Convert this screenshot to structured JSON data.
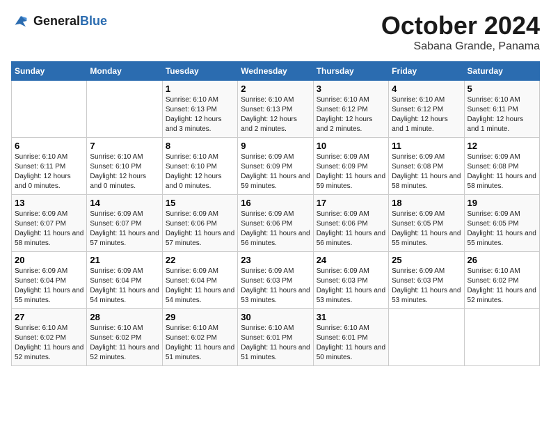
{
  "header": {
    "logo_line1": "General",
    "logo_line2": "Blue",
    "month": "October 2024",
    "location": "Sabana Grande, Panama"
  },
  "weekdays": [
    "Sunday",
    "Monday",
    "Tuesday",
    "Wednesday",
    "Thursday",
    "Friday",
    "Saturday"
  ],
  "weeks": [
    [
      {
        "day": "",
        "info": ""
      },
      {
        "day": "",
        "info": ""
      },
      {
        "day": "1",
        "info": "Sunrise: 6:10 AM\nSunset: 6:13 PM\nDaylight: 12 hours and 3 minutes."
      },
      {
        "day": "2",
        "info": "Sunrise: 6:10 AM\nSunset: 6:13 PM\nDaylight: 12 hours and 2 minutes."
      },
      {
        "day": "3",
        "info": "Sunrise: 6:10 AM\nSunset: 6:12 PM\nDaylight: 12 hours and 2 minutes."
      },
      {
        "day": "4",
        "info": "Sunrise: 6:10 AM\nSunset: 6:12 PM\nDaylight: 12 hours and 1 minute."
      },
      {
        "day": "5",
        "info": "Sunrise: 6:10 AM\nSunset: 6:11 PM\nDaylight: 12 hours and 1 minute."
      }
    ],
    [
      {
        "day": "6",
        "info": "Sunrise: 6:10 AM\nSunset: 6:11 PM\nDaylight: 12 hours and 0 minutes."
      },
      {
        "day": "7",
        "info": "Sunrise: 6:10 AM\nSunset: 6:10 PM\nDaylight: 12 hours and 0 minutes."
      },
      {
        "day": "8",
        "info": "Sunrise: 6:10 AM\nSunset: 6:10 PM\nDaylight: 12 hours and 0 minutes."
      },
      {
        "day": "9",
        "info": "Sunrise: 6:09 AM\nSunset: 6:09 PM\nDaylight: 11 hours and 59 minutes."
      },
      {
        "day": "10",
        "info": "Sunrise: 6:09 AM\nSunset: 6:09 PM\nDaylight: 11 hours and 59 minutes."
      },
      {
        "day": "11",
        "info": "Sunrise: 6:09 AM\nSunset: 6:08 PM\nDaylight: 11 hours and 58 minutes."
      },
      {
        "day": "12",
        "info": "Sunrise: 6:09 AM\nSunset: 6:08 PM\nDaylight: 11 hours and 58 minutes."
      }
    ],
    [
      {
        "day": "13",
        "info": "Sunrise: 6:09 AM\nSunset: 6:07 PM\nDaylight: 11 hours and 58 minutes."
      },
      {
        "day": "14",
        "info": "Sunrise: 6:09 AM\nSunset: 6:07 PM\nDaylight: 11 hours and 57 minutes."
      },
      {
        "day": "15",
        "info": "Sunrise: 6:09 AM\nSunset: 6:06 PM\nDaylight: 11 hours and 57 minutes."
      },
      {
        "day": "16",
        "info": "Sunrise: 6:09 AM\nSunset: 6:06 PM\nDaylight: 11 hours and 56 minutes."
      },
      {
        "day": "17",
        "info": "Sunrise: 6:09 AM\nSunset: 6:06 PM\nDaylight: 11 hours and 56 minutes."
      },
      {
        "day": "18",
        "info": "Sunrise: 6:09 AM\nSunset: 6:05 PM\nDaylight: 11 hours and 55 minutes."
      },
      {
        "day": "19",
        "info": "Sunrise: 6:09 AM\nSunset: 6:05 PM\nDaylight: 11 hours and 55 minutes."
      }
    ],
    [
      {
        "day": "20",
        "info": "Sunrise: 6:09 AM\nSunset: 6:04 PM\nDaylight: 11 hours and 55 minutes."
      },
      {
        "day": "21",
        "info": "Sunrise: 6:09 AM\nSunset: 6:04 PM\nDaylight: 11 hours and 54 minutes."
      },
      {
        "day": "22",
        "info": "Sunrise: 6:09 AM\nSunset: 6:04 PM\nDaylight: 11 hours and 54 minutes."
      },
      {
        "day": "23",
        "info": "Sunrise: 6:09 AM\nSunset: 6:03 PM\nDaylight: 11 hours and 53 minutes."
      },
      {
        "day": "24",
        "info": "Sunrise: 6:09 AM\nSunset: 6:03 PM\nDaylight: 11 hours and 53 minutes."
      },
      {
        "day": "25",
        "info": "Sunrise: 6:09 AM\nSunset: 6:03 PM\nDaylight: 11 hours and 53 minutes."
      },
      {
        "day": "26",
        "info": "Sunrise: 6:10 AM\nSunset: 6:02 PM\nDaylight: 11 hours and 52 minutes."
      }
    ],
    [
      {
        "day": "27",
        "info": "Sunrise: 6:10 AM\nSunset: 6:02 PM\nDaylight: 11 hours and 52 minutes."
      },
      {
        "day": "28",
        "info": "Sunrise: 6:10 AM\nSunset: 6:02 PM\nDaylight: 11 hours and 52 minutes."
      },
      {
        "day": "29",
        "info": "Sunrise: 6:10 AM\nSunset: 6:02 PM\nDaylight: 11 hours and 51 minutes."
      },
      {
        "day": "30",
        "info": "Sunrise: 6:10 AM\nSunset: 6:01 PM\nDaylight: 11 hours and 51 minutes."
      },
      {
        "day": "31",
        "info": "Sunrise: 6:10 AM\nSunset: 6:01 PM\nDaylight: 11 hours and 50 minutes."
      },
      {
        "day": "",
        "info": ""
      },
      {
        "day": "",
        "info": ""
      }
    ]
  ]
}
